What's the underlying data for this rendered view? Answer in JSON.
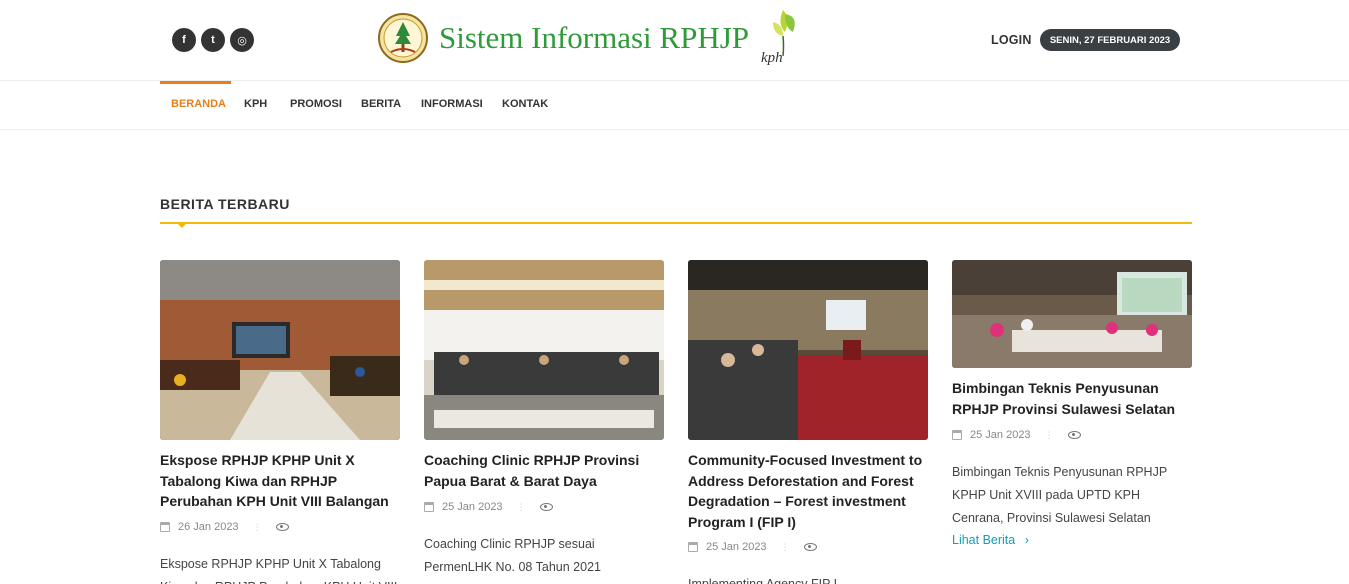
{
  "header": {
    "social": [
      {
        "icon": "facebook-icon",
        "glyph": "f"
      },
      {
        "icon": "twitter-icon",
        "glyph": "t"
      },
      {
        "icon": "instagram-icon",
        "glyph": "◎"
      }
    ],
    "site_title": "Sistem Informasi RPHJP",
    "kph_mark": "kph",
    "login_label": "LOGIN",
    "date_label": "SENIN, 27 FEBRUARI 2023"
  },
  "nav": {
    "items": [
      {
        "label": "BERANDA",
        "active": true
      },
      {
        "label": "KPH",
        "active": false
      },
      {
        "label": "PROMOSI",
        "active": false
      },
      {
        "label": "BERITA",
        "active": false
      },
      {
        "label": "INFORMASI",
        "active": false
      },
      {
        "label": "KONTAK",
        "active": false
      }
    ],
    "accent_color": "#e57f1d"
  },
  "section": {
    "title": "BERITA TERBARU",
    "line_color": "#f0b90b"
  },
  "news": [
    {
      "title": "Ekspose RPHJP KPHP Unit X Tabalong Kiwa dan RPHJP Perubahan KPH Unit VIII Balangan",
      "date": "26 Jan 2023",
      "excerpt": "Ekspose RPHJP KPHP Unit X Tabalong Kiwa dan RPHJP Perubahan KPH Unit VIII"
    },
    {
      "title": "Coaching Clinic RPHJP Provinsi Papua Barat & Barat Daya",
      "date": "25 Jan 2023",
      "excerpt": "Coaching Clinic RPHJP sesuai PermenLHK No. 08 Tahun 2021"
    },
    {
      "title": "Community-Focused Investment to Address Deforestation and Forest Degradation – Forest investment Program I (FIP I)",
      "date": "25 Jan 2023",
      "excerpt": "Implementing Agency FIP I"
    },
    {
      "title": "Bimbingan Teknis Penyusunan RPHJP Provinsi Sulawesi Selatan",
      "date": "25 Jan 2023",
      "excerpt": "Bimbingan Teknis Penyusunan RPHJP KPHP Unit XVIII pada UPTD KPH Cenrana, Provinsi Sulawesi Selatan",
      "read_more": "Lihat Berita"
    }
  ]
}
